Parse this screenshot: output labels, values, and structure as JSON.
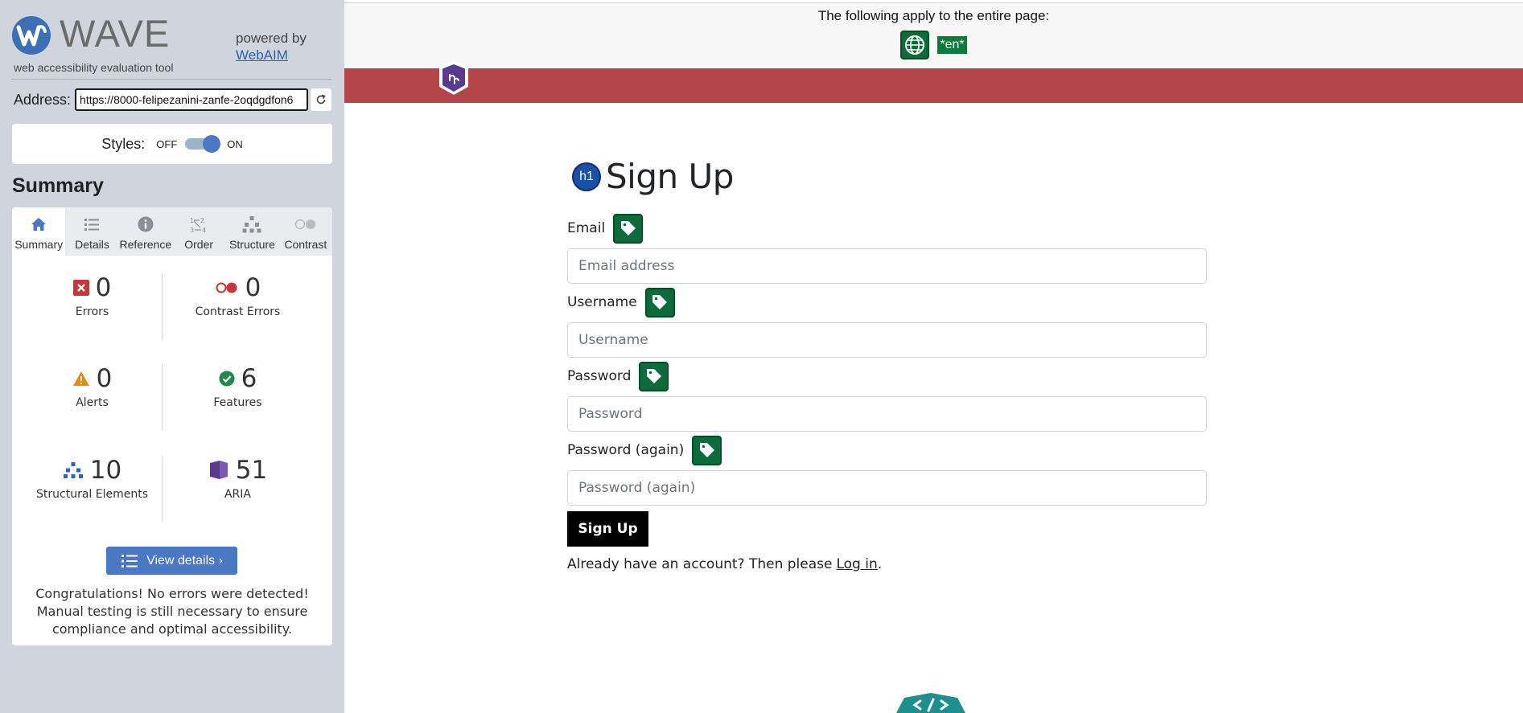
{
  "wave": {
    "brand": "WAVE",
    "tagline": "web accessibility evaluation tool",
    "powered_by": "powered by",
    "webaim": "WebAIM",
    "address_label": "Address:",
    "address_value": "https://8000-felipezanini-zanfe-2oqdgdfon6",
    "styles_label": "Styles:",
    "styles_off": "OFF",
    "styles_on": "ON",
    "styles_enabled": true,
    "summary_heading": "Summary",
    "tabs": [
      {
        "label": "Summary",
        "icon": "home-icon",
        "active": true
      },
      {
        "label": "Details",
        "icon": "list-icon",
        "active": false
      },
      {
        "label": "Reference",
        "icon": "info-icon",
        "active": false
      },
      {
        "label": "Order",
        "icon": "order-icon",
        "active": false
      },
      {
        "label": "Structure",
        "icon": "structure-icon",
        "active": false
      },
      {
        "label": "Contrast",
        "icon": "contrast-icon",
        "active": false
      }
    ],
    "stats": {
      "errors": {
        "value": "0",
        "label": "Errors",
        "color": "#c8353a"
      },
      "contrast_errors": {
        "value": "0",
        "label": "Contrast Errors",
        "color": "#c8353a"
      },
      "alerts": {
        "value": "0",
        "label": "Alerts",
        "color": "#e38b12"
      },
      "features": {
        "value": "6",
        "label": "Features",
        "color": "#1f8a4c"
      },
      "structural": {
        "value": "10",
        "label": "Structural Elements",
        "color": "#2f63c0"
      },
      "aria": {
        "value": "51",
        "label": "ARIA",
        "color": "#5a3a8e"
      }
    },
    "view_details": "View details ›",
    "congrats": "Congratulations! No errors were detected! Manual testing is still necessary to ensure compliance and optimal accessibility."
  },
  "page": {
    "banner_text": "The following apply to the entire page:",
    "lang_badge": "*en*",
    "h1_badge": "h1",
    "title": "Sign Up",
    "fields": [
      {
        "label": "Email",
        "placeholder": "Email address"
      },
      {
        "label": "Username",
        "placeholder": "Username"
      },
      {
        "label": "Password",
        "placeholder": "Password"
      },
      {
        "label": "Password (again)",
        "placeholder": "Password (again)"
      }
    ],
    "submit": "Sign Up",
    "account_text": "Already have an account? Then please",
    "login_link": "Log in",
    "account_end": "."
  },
  "colors": {
    "sidebar_bg": "#d0d5dd",
    "accent_blue": "#4a78c2",
    "navbar_red": "#b5454a",
    "wave_green": "#0b6b3a",
    "button_black": "#000000"
  }
}
